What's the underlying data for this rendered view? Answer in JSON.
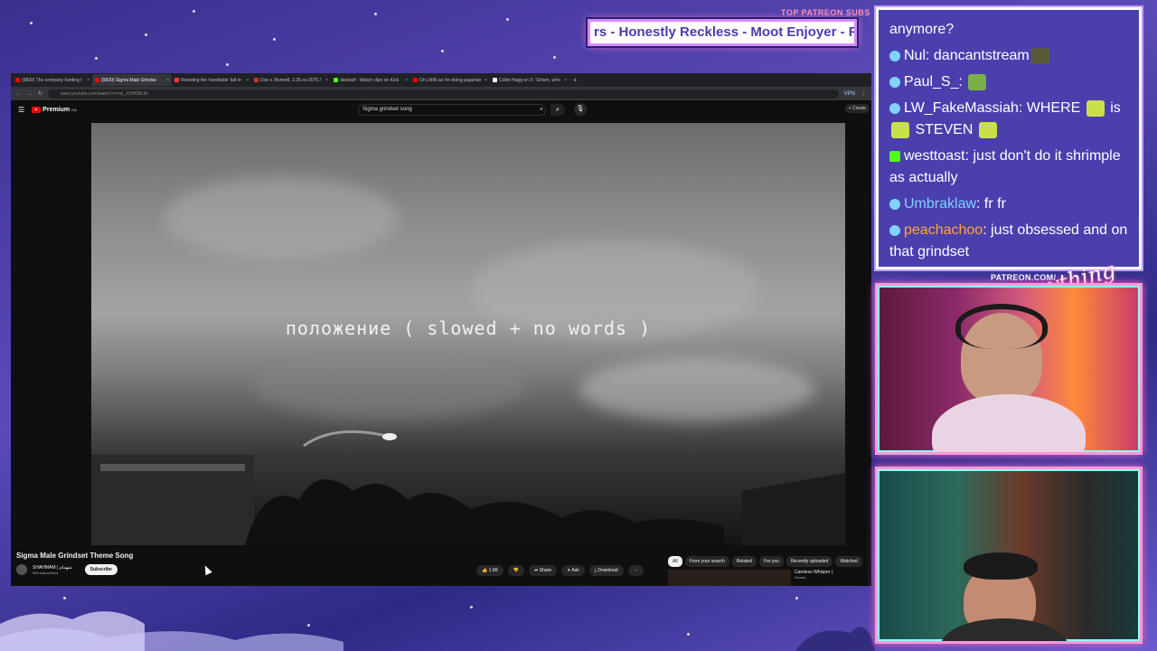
{
  "overlay": {
    "subs_label": "TOP PATREON SUBS",
    "subs_ticker": "rs - Honestly Reckless - Moot Enjoyer - Ro",
    "patreon_url": "PATREON.COM/",
    "brand_script": "Anything Else?"
  },
  "browser": {
    "tabs": [
      {
        "label": "(9820) The company funding t",
        "color": "#ff0000",
        "active": false
      },
      {
        "label": "(9820) Sigma Male Grindse",
        "color": "#ff0000",
        "active": true
      },
      {
        "label": "Resisting the 'inevitable' fall to",
        "color": "#ff3b30",
        "active": false
      },
      {
        "label": "Doe v. Bonnell, 1:25-cv-2075 /",
        "color": "#c0392b",
        "active": false
      },
      {
        "label": "dantusif - Watch clips on Kick",
        "color": "#53fc18",
        "active": false
      },
      {
        "label": "On LNIN as I'm doing paparwo",
        "color": "#ff0000",
        "active": false
      },
      {
        "label": "Collin Hagg on X: 'Ghism, who",
        "color": "#ffffff",
        "active": false
      }
    ],
    "new_tab": "+",
    "url": "www.youtube.com/watch?v=xxl_1OHD8LKf",
    "vpn": "VPN"
  },
  "youtube": {
    "logo": "Premium",
    "logo_sup": "CA",
    "search_value": "Sigma grindset song",
    "create_label": "+ Create",
    "caption": "положение ( slowed + no words )",
    "video_title": "Sigma Male Grindset Theme Song",
    "channel_name": "SHAHMAM | شهمام",
    "channel_subs": "906 subscribers",
    "subscribe_label": "Subscribe",
    "like_count": "1.9K",
    "share_label": "Share",
    "ask_label": "Ask",
    "download_label": "Download",
    "more_label": "···",
    "chips": [
      "All",
      "From your search",
      "Related",
      "For you",
      "Recently uploaded",
      "Watched"
    ],
    "related_title": "Careless Whisper (",
    "related_channel": "Gosaix"
  },
  "chat": {
    "messages": [
      {
        "user": "",
        "text": "anymore?"
      },
      {
        "user": "Nul",
        "text": "dancantstream"
      },
      {
        "user": "Paul_S_",
        "text": ""
      },
      {
        "user": "LW_FakeMassiah",
        "text": "WHERE",
        "text2": "is",
        "text3": "STEVEN"
      },
      {
        "user": "westtoast",
        "text": "just don't do it shrimple as actually"
      },
      {
        "user": "Umbraklaw",
        "text": "fr fr"
      },
      {
        "user": "peachachoo",
        "text": "just obsessed and on that grindset"
      }
    ]
  }
}
